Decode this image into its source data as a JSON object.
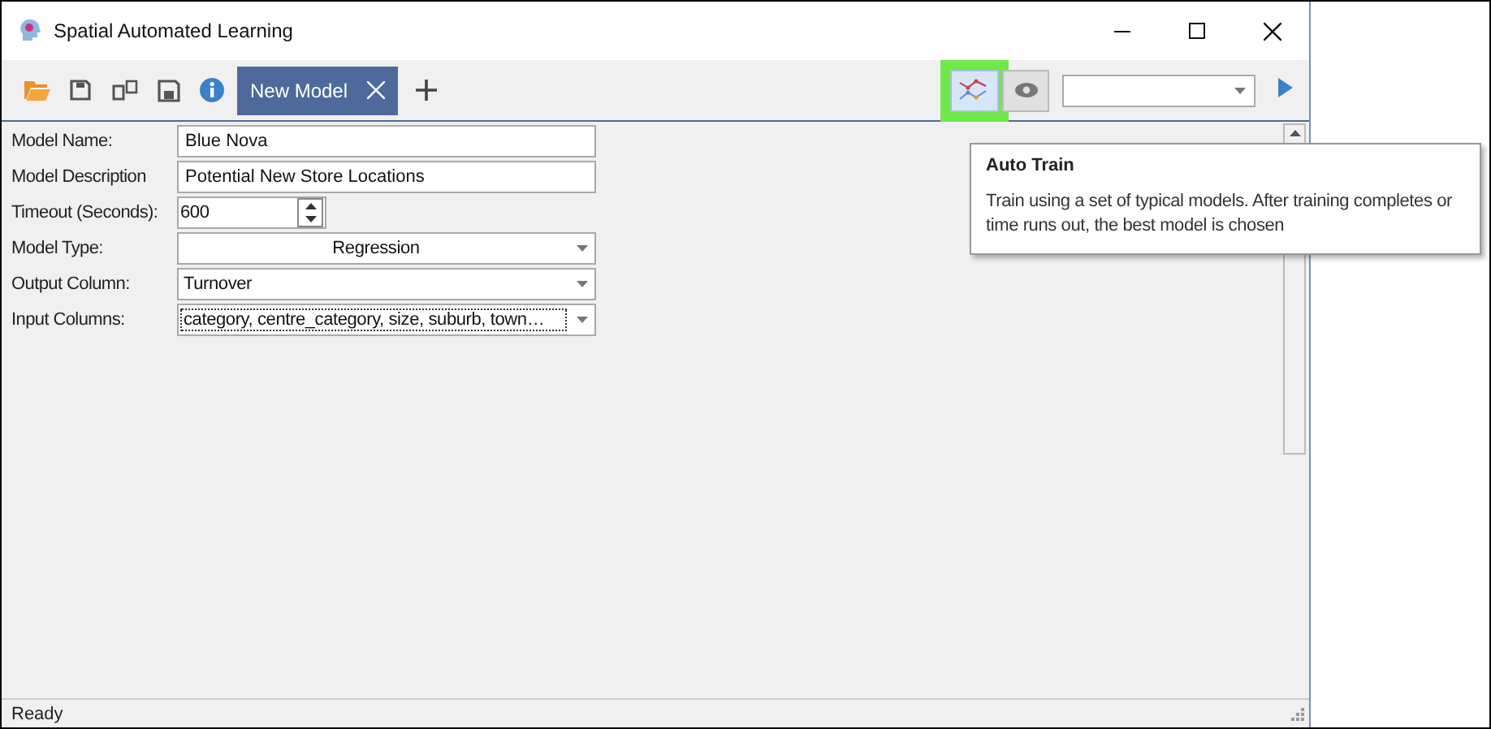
{
  "window": {
    "title": "Spatial Automated Learning"
  },
  "tabs": [
    {
      "label": "New Model",
      "selected": true
    }
  ],
  "auto_train_button": {
    "highlighted": true
  },
  "tooltip": {
    "title": "Auto Train",
    "text": "Train using a set of typical models. After training completes or time runs out, the best model is chosen"
  },
  "form": {
    "fields": [
      {
        "label": "Model Name:",
        "kind": "text",
        "value": "Blue Nova"
      },
      {
        "label": "Model Description",
        "kind": "text",
        "value": "Potential New Store Locations"
      },
      {
        "label": "Timeout (Seconds):",
        "kind": "spin",
        "value": "600"
      },
      {
        "label": "Model Type:",
        "kind": "dropdown",
        "value": "Regression",
        "centered": true
      },
      {
        "label": "Output Column:",
        "kind": "dropdown",
        "value": "Turnover"
      },
      {
        "label": "Input Columns:",
        "kind": "dropdown",
        "value": "category, centre_category, size, suburb, town…",
        "focused": true
      }
    ]
  },
  "status_bar": "Ready"
}
